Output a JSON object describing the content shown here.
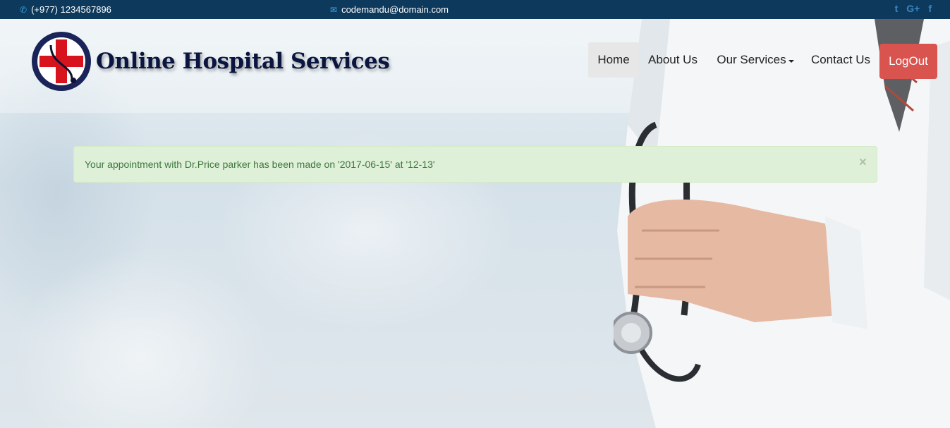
{
  "topbar": {
    "phone": "(+977) 1234567896",
    "email": "codemandu@domain.com",
    "social": {
      "twitter": "t",
      "google_plus": "G+",
      "facebook": "f"
    }
  },
  "header": {
    "brand": "Online Hospital Services"
  },
  "nav": {
    "items": [
      {
        "label": "Home"
      },
      {
        "label": "About Us"
      },
      {
        "label": "Our Services"
      },
      {
        "label": "Contact Us"
      }
    ],
    "logout_label": "LogOut"
  },
  "alert": {
    "message": "Your appointment with Dr.Price parker has been made on '2017-06-15' at '12-13'",
    "close_glyph": "×"
  }
}
